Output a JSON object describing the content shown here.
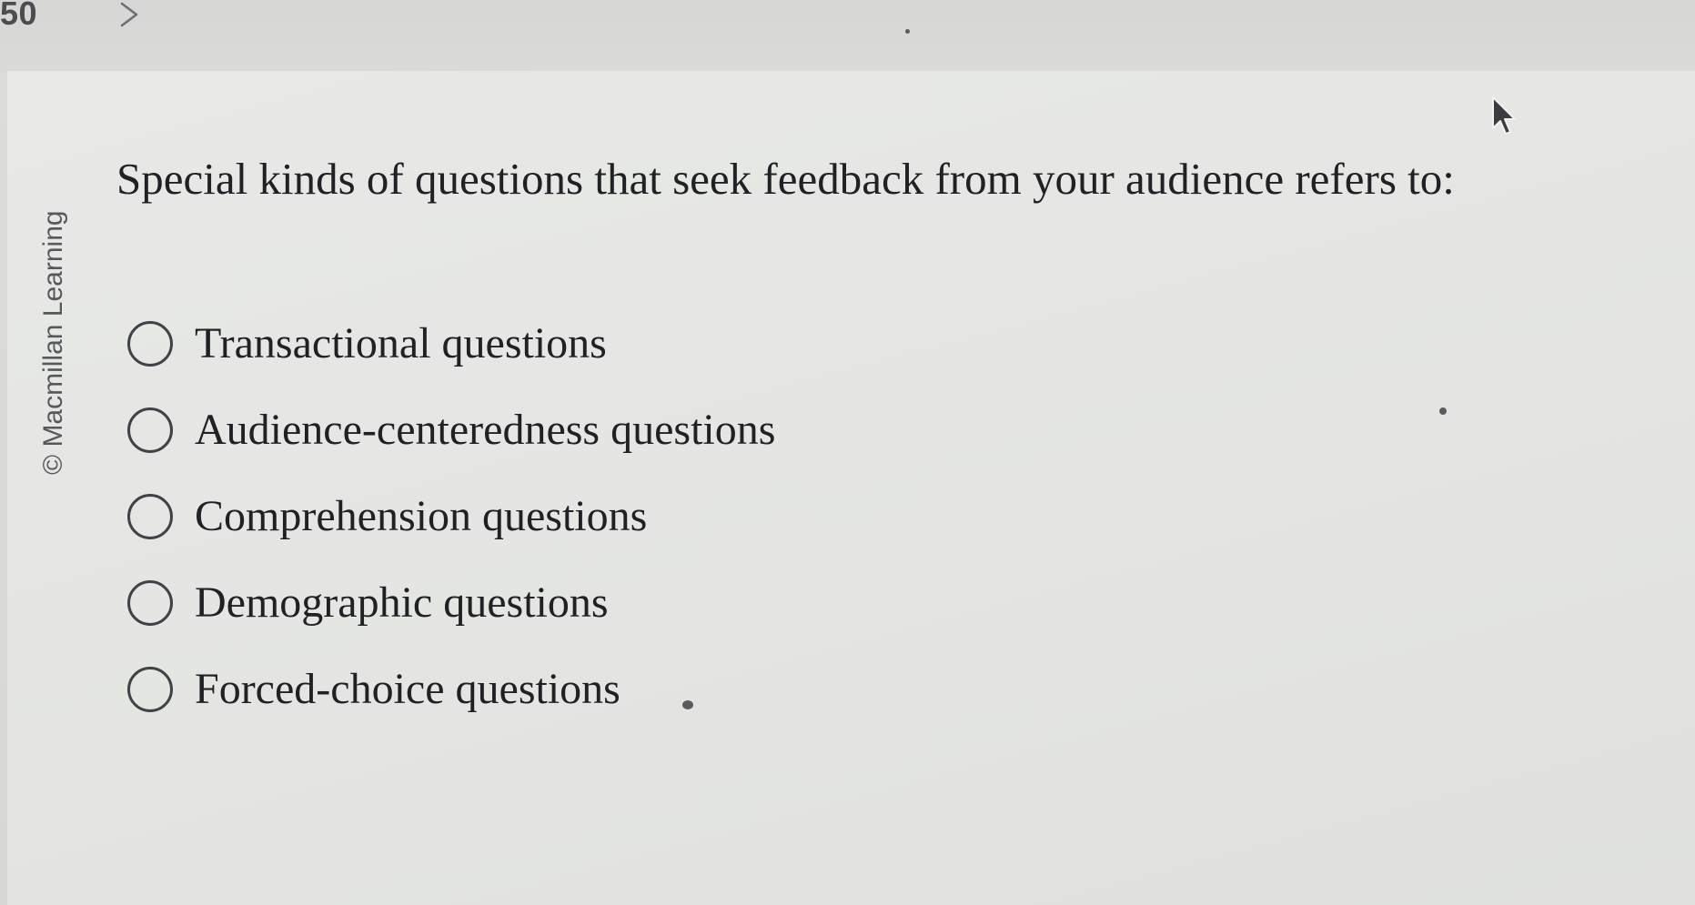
{
  "header": {
    "question_number": "50"
  },
  "watermark": {
    "text": "© Macmillan Learning"
  },
  "question": {
    "text": "Special kinds of questions that seek feedback from your audience refers to:"
  },
  "options": [
    {
      "label": "Transactional questions",
      "selected": false
    },
    {
      "label": "Audience-centeredness questions",
      "selected": false
    },
    {
      "label": "Comprehension questions",
      "selected": false
    },
    {
      "label": "Demographic questions",
      "selected": false
    },
    {
      "label": "Forced-choice questions",
      "selected": false
    }
  ],
  "icons": {
    "next": "chevron-right-icon",
    "radio": "radio-button-icon",
    "cursor": "mouse-pointer-icon"
  },
  "colors": {
    "text": "#1f2124",
    "radio_border": "#3f4246",
    "watermark": "#55585c"
  }
}
